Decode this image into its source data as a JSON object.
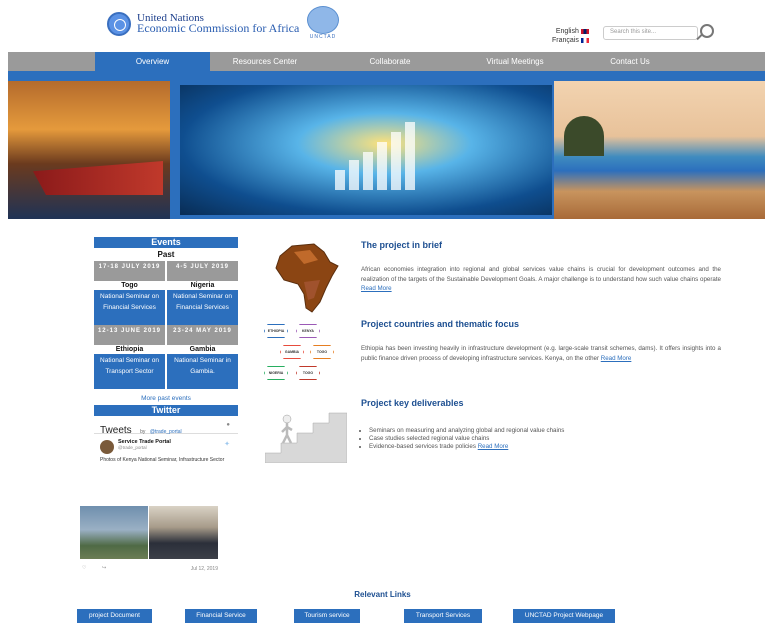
{
  "header": {
    "org_line1": "United Nations",
    "org_line2": "Economic Commission for Africa",
    "unctad_text": "UNCTAD",
    "lang_en": "English",
    "lang_fr": "Français",
    "search_placeholder": "Search this site..."
  },
  "nav": {
    "items": [
      {
        "label": "Overview"
      },
      {
        "label": "Resources Center"
      },
      {
        "label": "Collaborate"
      },
      {
        "label": "Virtual Meetings"
      },
      {
        "label": "Contact Us"
      }
    ]
  },
  "events": {
    "heading": "Events",
    "subheading": "Past",
    "items": [
      {
        "date": "17-18 JULY 2019",
        "place": "Togo",
        "title": "National Seminar on Financial Services"
      },
      {
        "date": "4-5 JULY 2019",
        "place": "Nigeria",
        "title": "National Seminar on Financial Services"
      },
      {
        "date": "12-13 JUNE 2019",
        "place": "Ethiopia",
        "title": "National Seminar on Transport Sector"
      },
      {
        "date": "23-24 MAY 2019",
        "place": "Gambia",
        "title": "National Seminar in Gambia."
      }
    ],
    "more_label": "More past events"
  },
  "twitter": {
    "heading": "Twitter",
    "tweets_label": "Tweets",
    "by_label": "by",
    "handle": "@trade_portal",
    "tweet_name": "Service Trade Portal",
    "tweet_handle": "@trade_portal",
    "tweet_text": "Photos of Kenya National Seminar, Infrastructure Sector",
    "tweet_date": "Jul 12, 2019"
  },
  "hexagons": [
    "ETHIOPIA",
    "KENYA",
    "GAMBIA",
    "TOGO",
    "NIGERIA",
    "TOGO"
  ],
  "content": {
    "brief_title": "The project in brief",
    "brief_text": "African economies integration into regional and global services value chains is crucial for development outcomes and the realization of the targets of the Sustainable Development Goals. A major challenge is to understand how such value chains operate",
    "countries_title": "Project countries and thematic focus",
    "countries_text": "Ethiopia has been investing heavily in infrastructure development (e.g. large-scale transit schemes, dams). It offers insights into a public finance driven process of developing infrastructure services. Kenya, on the other",
    "deliverables_title": "Project key deliverables",
    "deliverables": [
      "Seminars on measuring and analyzing global and regional value chains",
      "Case studies selected regional value chains",
      "Evidence-based services trade policies"
    ],
    "read_more": "Read More"
  },
  "links": {
    "heading": "Relevant Links",
    "buttons": [
      {
        "label": "project Document"
      },
      {
        "label": "Financial Service"
      },
      {
        "label": "Tourism service"
      },
      {
        "label": "Transport Services"
      },
      {
        "label": "UNCTAD Project Webpage"
      }
    ]
  },
  "colors": {
    "primary_blue": "#2c6fbd",
    "nav_gray": "#9a9a9a",
    "title_blue": "#1d4f91"
  }
}
